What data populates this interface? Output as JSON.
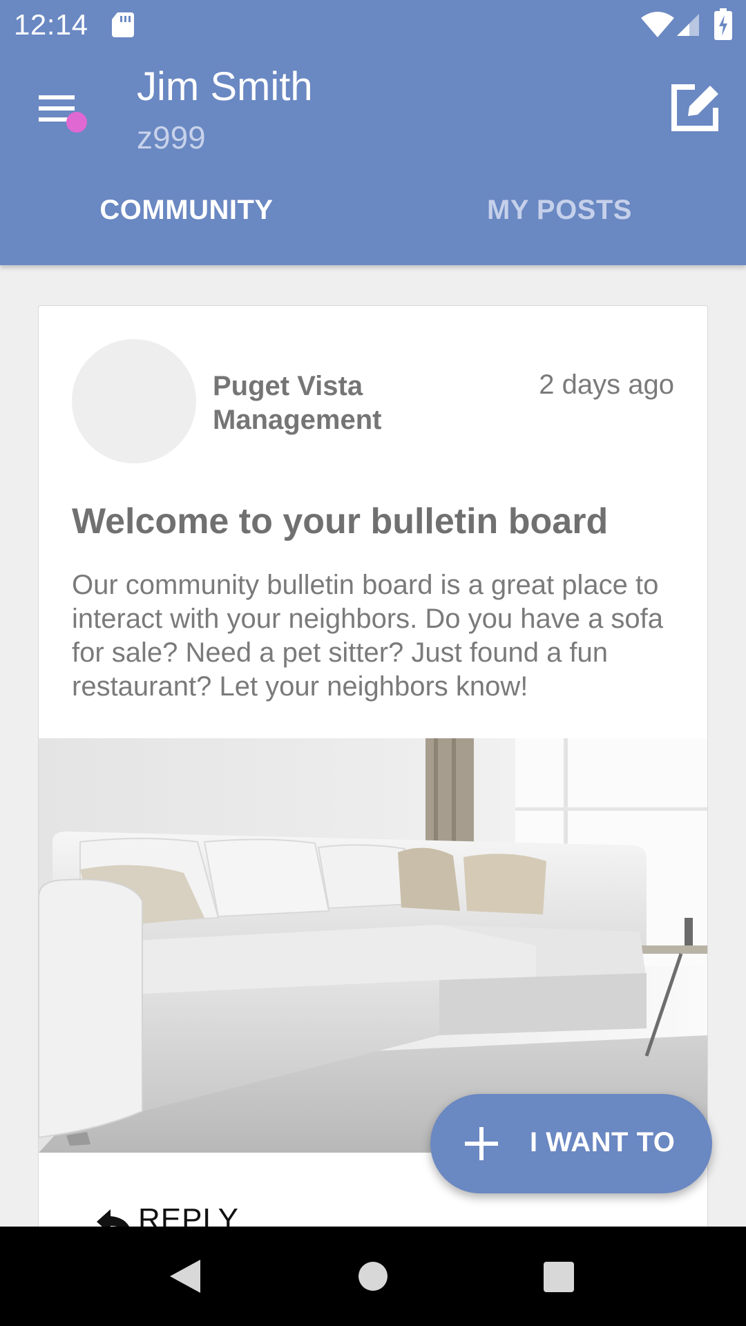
{
  "status_bar": {
    "time": "12:14",
    "icons": [
      "sd-card-icon",
      "wifi-icon",
      "signal-icon",
      "battery-charging-icon"
    ]
  },
  "header": {
    "user_name": "Jim Smith",
    "user_code": "z999",
    "menu_icon": "menu-icon",
    "compose_icon": "compose-icon",
    "notification_dot_color": "#e068d2"
  },
  "tabs": [
    {
      "label": "COMMUNITY",
      "selected": true
    },
    {
      "label": "MY POSTS",
      "selected": false
    }
  ],
  "post": {
    "author": "Puget Vista Management",
    "time_ago": "2 days ago",
    "title": "Welcome to your bulletin board",
    "body": "Our community bulletin board is a great place to interact with your neighbors.  Do you have a sofa for sale?  Need a pet sitter?  Just found a fun restaurant?  Let your neighbors know!",
    "image": "white-sectional-sofa-photo",
    "reply_label": "REPLY"
  },
  "fab": {
    "label": "I WANT TO",
    "icon": "plus-icon"
  },
  "colors": {
    "primary": "#6a88c2",
    "background": "#efefef",
    "card": "#ffffff"
  },
  "nav_bar": {
    "icons": [
      "back-icon",
      "home-icon",
      "recents-icon"
    ]
  }
}
